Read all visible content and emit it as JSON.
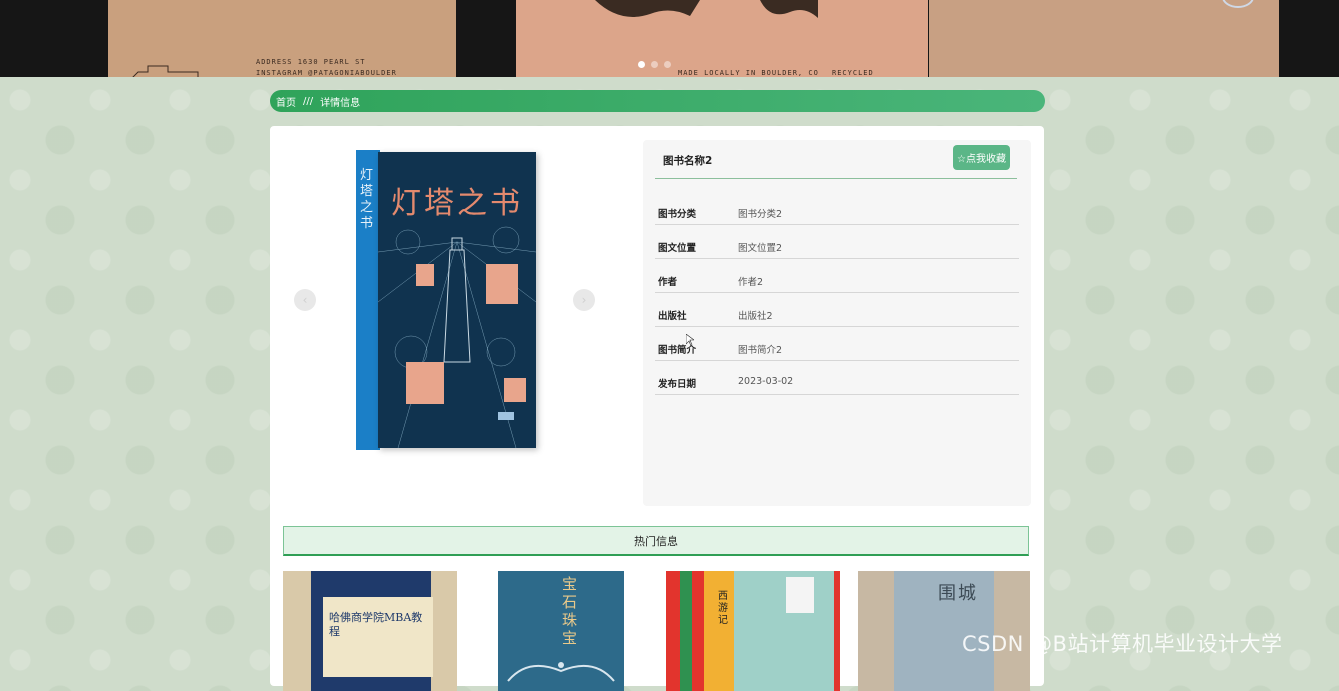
{
  "banner": {
    "slide1_lines": [
      "ADDRESS     1630 PEARL ST",
      "INSTAGRAM   @PATAGONIABOULDER"
    ],
    "slide2_lines": [
      "MADE LOCALLY IN BOULDER, CO",
      "RECYCLED"
    ],
    "dots": 3,
    "active_dot": 0
  },
  "breadcrumb": {
    "home": "首页",
    "separator": "///",
    "current": "详情信息"
  },
  "book": {
    "cover_title": "灯塔之书",
    "spine_title": "灯塔之书",
    "name": "图书名称2",
    "favorite_label": "☆点我收藏",
    "fields": [
      {
        "label": "图书分类",
        "value": "图书分类2"
      },
      {
        "label": "图文位置",
        "value": "图文位置2"
      },
      {
        "label": "作者",
        "value": "作者2"
      },
      {
        "label": "出版社",
        "value": "出版社2"
      },
      {
        "label": "图书简介",
        "value": "图书简介2"
      },
      {
        "label": "发布日期",
        "value": "2023-03-02"
      }
    ]
  },
  "carousel": {
    "prev_icon": "chevron-left-icon",
    "next_icon": "chevron-right-icon"
  },
  "hot": {
    "title": "热门信息",
    "items": [
      {
        "cover_text": "哈佛商学院MBA教程"
      },
      {
        "cover_text": "宝石珠宝"
      },
      {
        "cover_text": "西游记"
      },
      {
        "cover_text": "围城"
      }
    ]
  },
  "watermark": "CSDN @B站计算机毕业设计大学"
}
